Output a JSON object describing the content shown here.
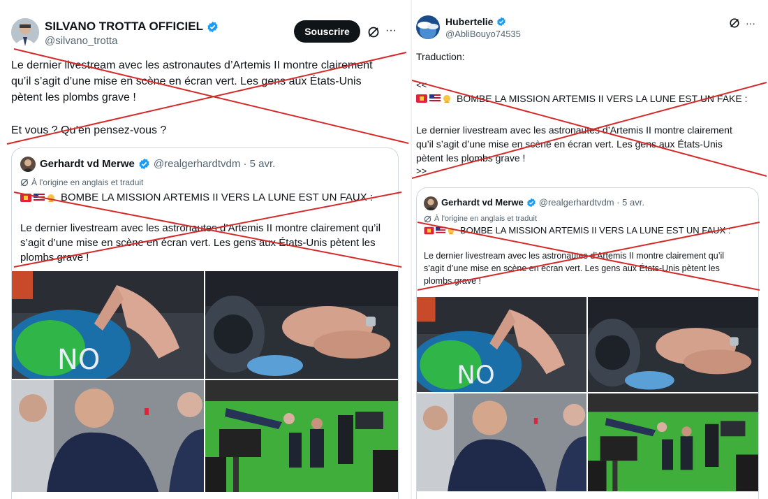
{
  "left_post": {
    "author_name": "SILVANO TROTTA OFFICIEL",
    "author_handle": "@silvano_trotta",
    "subscribe_label": "Souscrire",
    "more_label": "···",
    "body_line1": "Le dernier livestream avec les astronautes d’Artemis II montre clairement",
    "body_line2": "qu’il s’agit d’une mise en scène en écran vert. Les gens aux États-Unis",
    "body_line3": "pètent les plombs grave !",
    "body_question": "Et vous ? Qu’en pensez-vous ?",
    "quote": {
      "author_name": "Gerhardt vd Merwe",
      "author_meta": "@realgerhardtvdm · 5 avr.",
      "translated_note": "À l'origine en anglais et traduit",
      "headline": "BOMBE LA MISSION ARTEMIS II VERS LA LUNE EST UN FAUX :",
      "body_line1": "Le dernier livestream avec les astronautes d’Artemis II montre clairement qu’il",
      "body_line2": "s’agit d’une mise en scène en écran vert. Les gens aux États-Unis pètent les",
      "body_line3": "plombs grave !"
    }
  },
  "right_post": {
    "author_name": "Hubertelie",
    "author_handle": "@AbliBouyo74535",
    "more_label": "···",
    "translation_label": "Traduction:",
    "open_marks": "<<",
    "headline": "BOMBE LA MISSION ARTEMIS II VERS LA LUNE EST UN FAKE :",
    "body_line1": "Le dernier livestream avec les astronautes d’Artemis II montre clairement",
    "body_line2": "qu’il s’agit d’une mise en scène en écran vert. Les gens aux États-Unis",
    "body_line3": "pètent les plombs grave !",
    "close_marks": ">>",
    "quote": {
      "author_name": "Gerhardt vd Merwe",
      "author_meta": "@realgerhardtvdm · 5 avr.",
      "translated_note": "À l'origine en anglais et traduit",
      "headline": "BOMBE LA MISSION ARTEMIS II VERS LA LUNE EST UN FAUX :",
      "body_line1": "Le dernier livestream avec les astronautes d’Artemis II montre clairement qu’il",
      "body_line2": "s’agit d’une mise en scène en écran vert. Les gens aux États-Unis pètent les",
      "body_line3": "plombs grave !"
    }
  },
  "colors": {
    "verified_blue": "#1d9bf0",
    "cross_red": "#d42a2a",
    "green_screen": "#3fae3a"
  },
  "icons": [
    "verified-badge-icon",
    "grok-icon",
    "more-icon",
    "translate-icon",
    "flag-icons"
  ]
}
